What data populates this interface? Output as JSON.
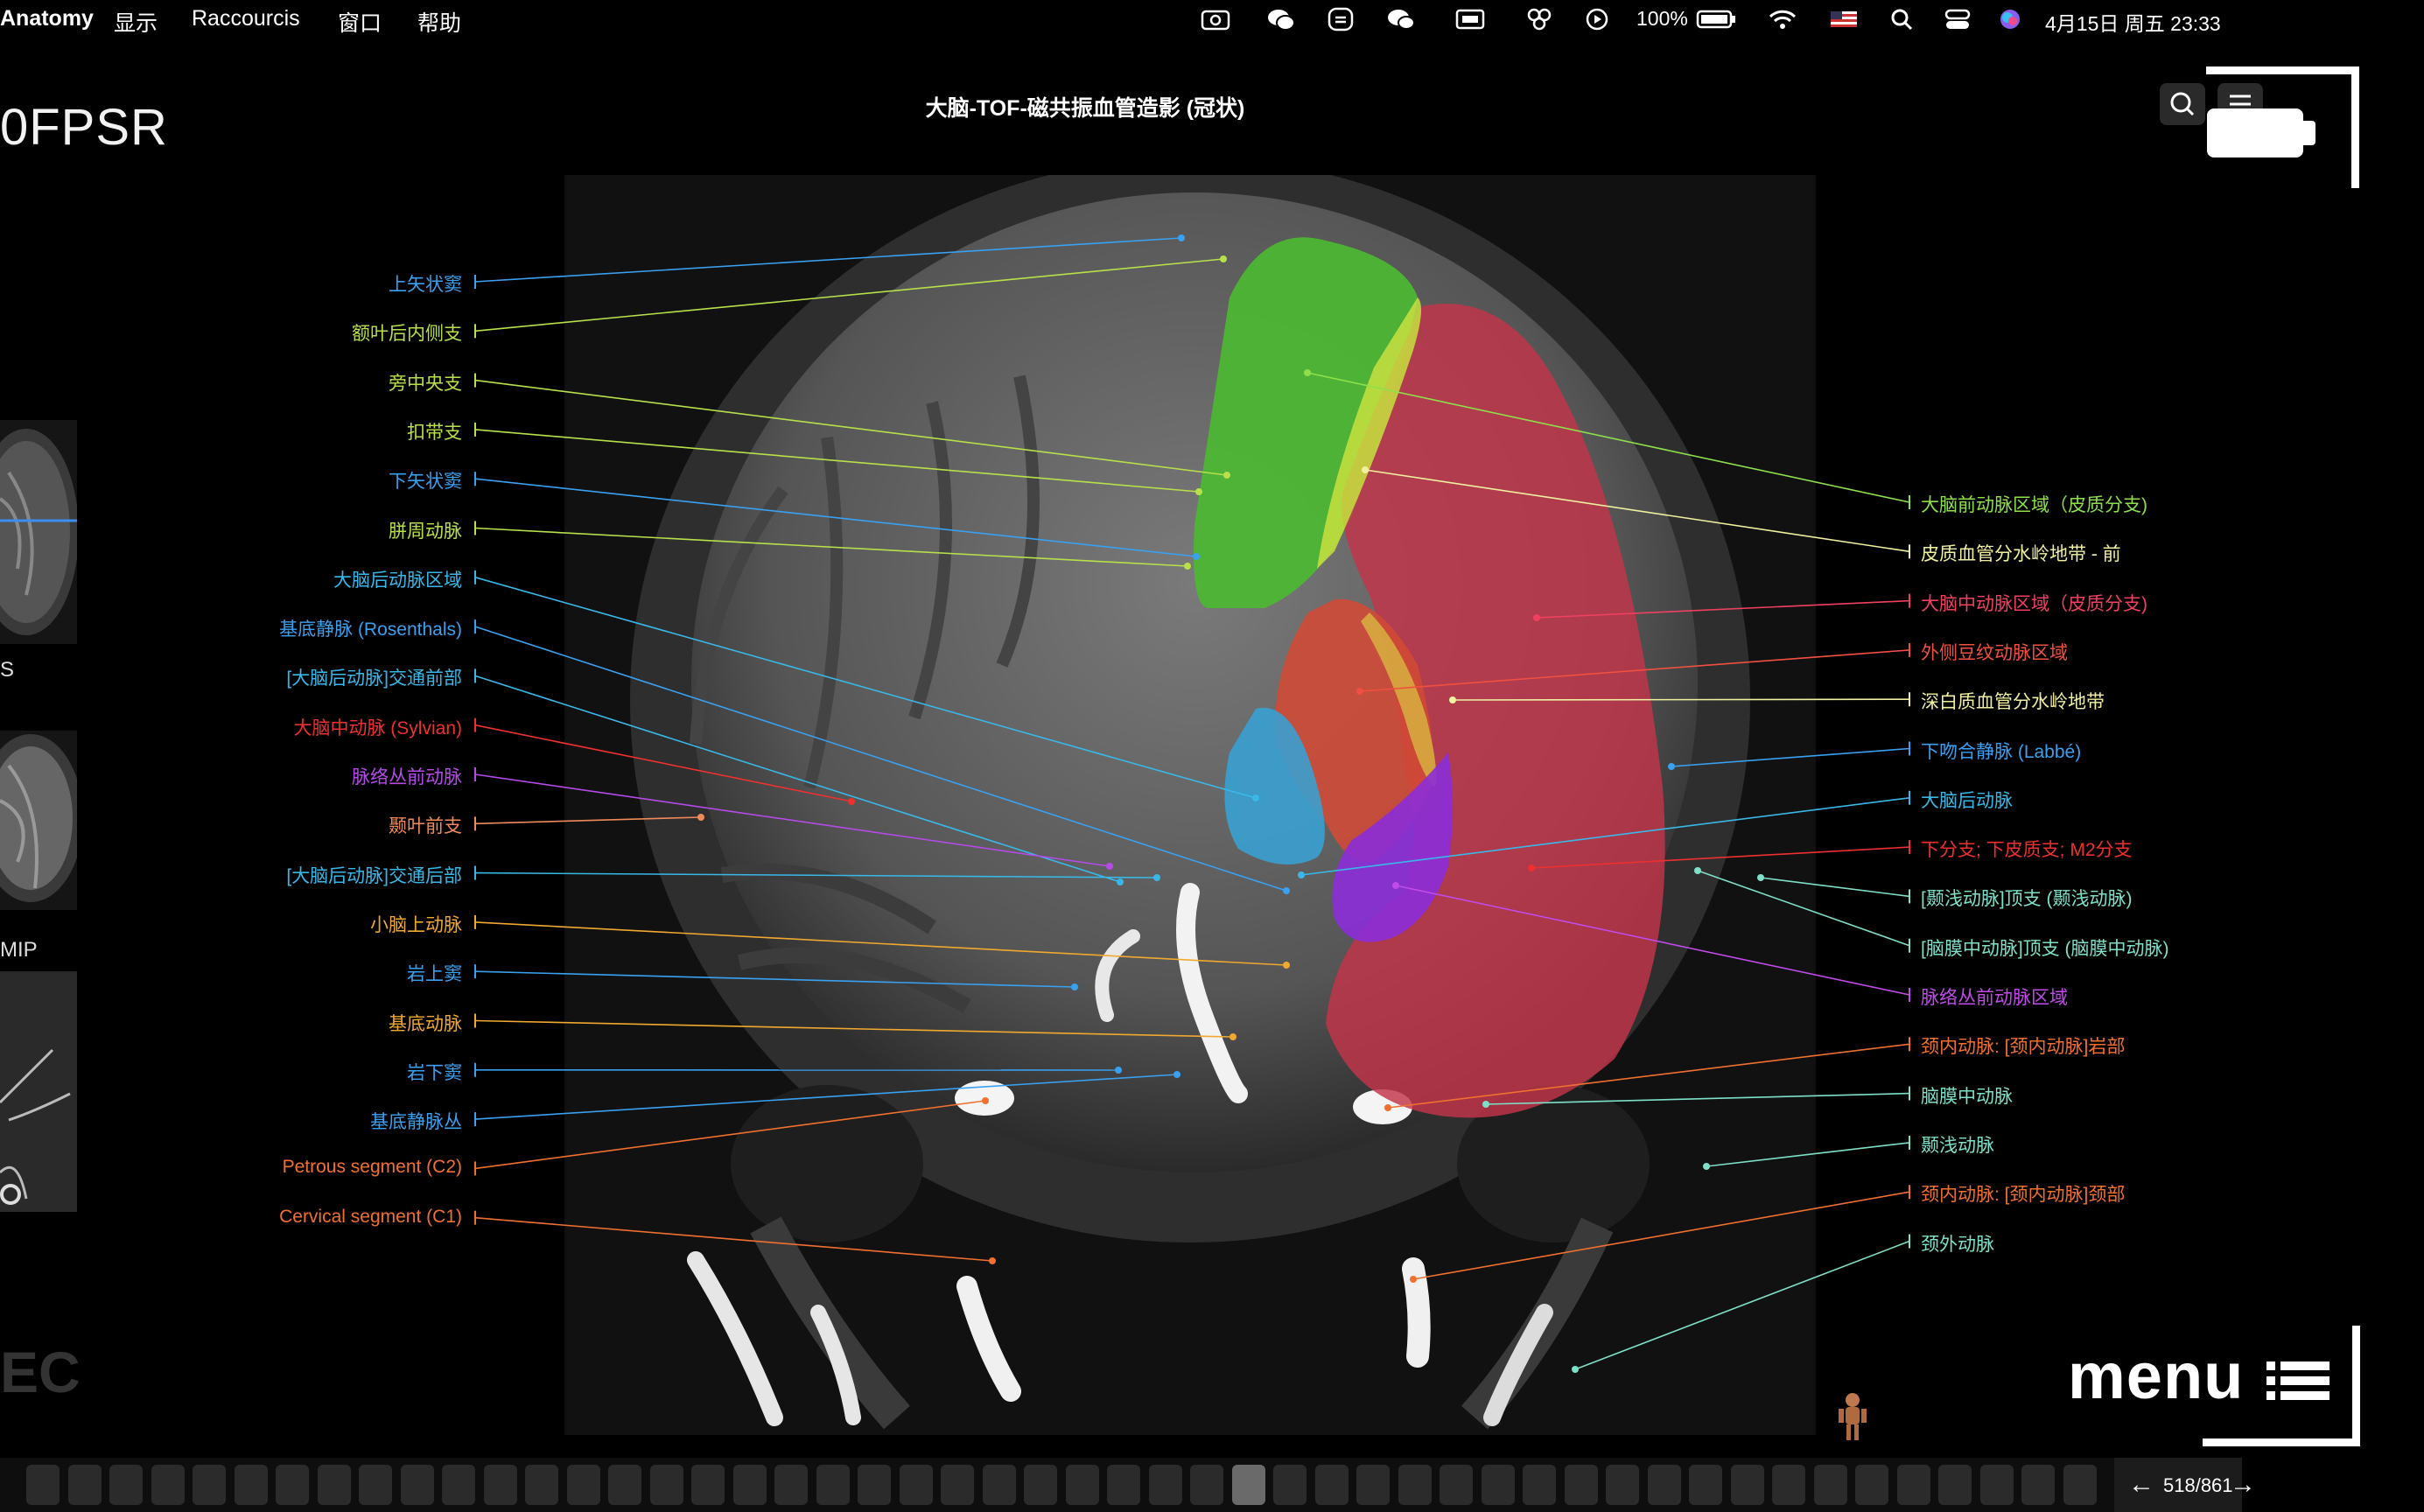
{
  "menubar": {
    "app_name": "Anatomy",
    "items": [
      "显示",
      "Raccourcis",
      "窗口",
      "帮助"
    ],
    "battery_percent": "100%",
    "datetime": "4月15日 周五 23:33"
  },
  "app_title": "0FPSR",
  "image_title": "大脑-TOF-磁共振血管造影 (冠状)",
  "thumbnail_labels": [
    "S",
    "MIP"
  ],
  "ec_text": "EC",
  "left_labels": [
    {
      "text": "上矢状窦",
      "color": "#3aa0f0"
    },
    {
      "text": "额叶后内侧支",
      "color": "#b8e04a"
    },
    {
      "text": "旁中央支",
      "color": "#b8e04a"
    },
    {
      "text": "扣带支",
      "color": "#b8e04a"
    },
    {
      "text": "下矢状窦",
      "color": "#3aa0f0"
    },
    {
      "text": "胼周动脉",
      "color": "#b8e04a"
    },
    {
      "text": "大脑后动脉区域",
      "color": "#39b8e8"
    },
    {
      "text": "基底静脉 (Rosenthals)",
      "color": "#3aa0f0"
    },
    {
      "text": "[大脑后动脉]交通前部",
      "color": "#39b8e8"
    },
    {
      "text": "大脑中动脉 (Sylvian)",
      "color": "#ee3030"
    },
    {
      "text": "脉络丛前动脉",
      "color": "#b44be8"
    },
    {
      "text": "颞叶前支",
      "color": "#f08a5a"
    },
    {
      "text": "[大脑后动脉]交通后部",
      "color": "#39b8e8"
    },
    {
      "text": "小脑上动脉",
      "color": "#f0a830"
    },
    {
      "text": "岩上窦",
      "color": "#3aa0f0"
    },
    {
      "text": "基底动脉",
      "color": "#f0a830"
    },
    {
      "text": "岩下窦",
      "color": "#3aa0f0"
    },
    {
      "text": "基底静脉丛",
      "color": "#3aa0f0"
    },
    {
      "text": "Petrous segment (C2)",
      "color": "#f07030"
    },
    {
      "text": "Cervical segment (C1)",
      "color": "#f07030"
    }
  ],
  "right_labels": [
    {
      "text": "大脑前动脉区域（皮质分支)",
      "color": "#8ee04a"
    },
    {
      "text": "皮质血管分水岭地带 - 前",
      "color": "#f0f0a0"
    },
    {
      "text": "大脑中动脉区域（皮质分支)",
      "color": "#f04060"
    },
    {
      "text": "外侧豆纹动脉区域",
      "color": "#f05040"
    },
    {
      "text": "深白质血管分水岭地带",
      "color": "#f0f0a0"
    },
    {
      "text": "下吻合静脉 (Labbé)",
      "color": "#3aa0f0"
    },
    {
      "text": "大脑后动脉",
      "color": "#39b8e8"
    },
    {
      "text": "下分支; 下皮质支; M2分支",
      "color": "#ee3030"
    },
    {
      "text": "[颞浅动脉]顶支 (颞浅动脉)",
      "color": "#7ee0c8"
    },
    {
      "text": "[脑膜中动脉]顶支 (脑膜中动脉)",
      "color": "#7ee0c8"
    },
    {
      "text": "脉络丛前动脉区域",
      "color": "#c04be8"
    },
    {
      "text": "颈内动脉: [颈内动脉]岩部",
      "color": "#f07030"
    },
    {
      "text": "脑膜中动脉",
      "color": "#7ee0c8"
    },
    {
      "text": "颞浅动脉",
      "color": "#7ee0c8"
    },
    {
      "text": "颈内动脉: [颈内动脉]颈部",
      "color": "#f07030"
    },
    {
      "text": "颈外动脉",
      "color": "#7ee0c8"
    }
  ],
  "menu_logo": "menu",
  "pager": {
    "prev": "←",
    "count": "518/861",
    "next": "→"
  }
}
